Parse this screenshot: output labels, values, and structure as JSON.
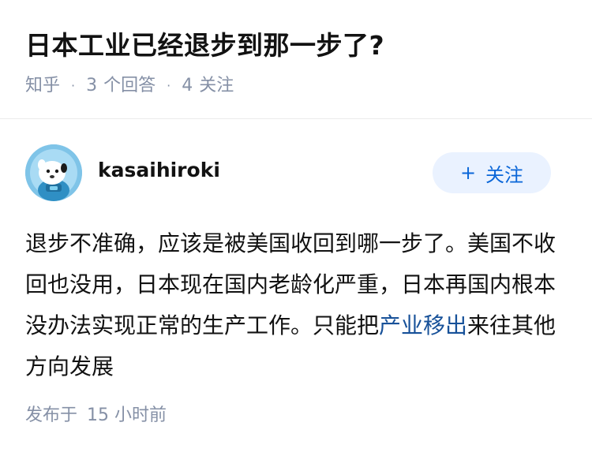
{
  "question": {
    "title": "日本工业已经退步到那一步了?",
    "source": "知乎",
    "separator": "·",
    "answer_count": "3",
    "answer_label": "个回答",
    "follower_count": "4",
    "follower_label": "关注"
  },
  "answer": {
    "author": "kasaihiroki",
    "follow_button": {
      "icon": "+",
      "label": "关注"
    },
    "content_before_link": "退步不准确，应该是被美国收回到哪一步了。美国不收回也没用，日本现在国内老龄化严重，日本再国内根本没办法实现正常的生产工作。只能把",
    "link_text": "产业移出",
    "content_after_link": "来往其他方向发展",
    "published_label": "发布于",
    "published_time": "15 小时前"
  },
  "colors": {
    "meta_gray": "#8590a6",
    "link_blue": "#175199",
    "button_bg": "#eaf2ff",
    "button_text": "#0a66d8"
  }
}
